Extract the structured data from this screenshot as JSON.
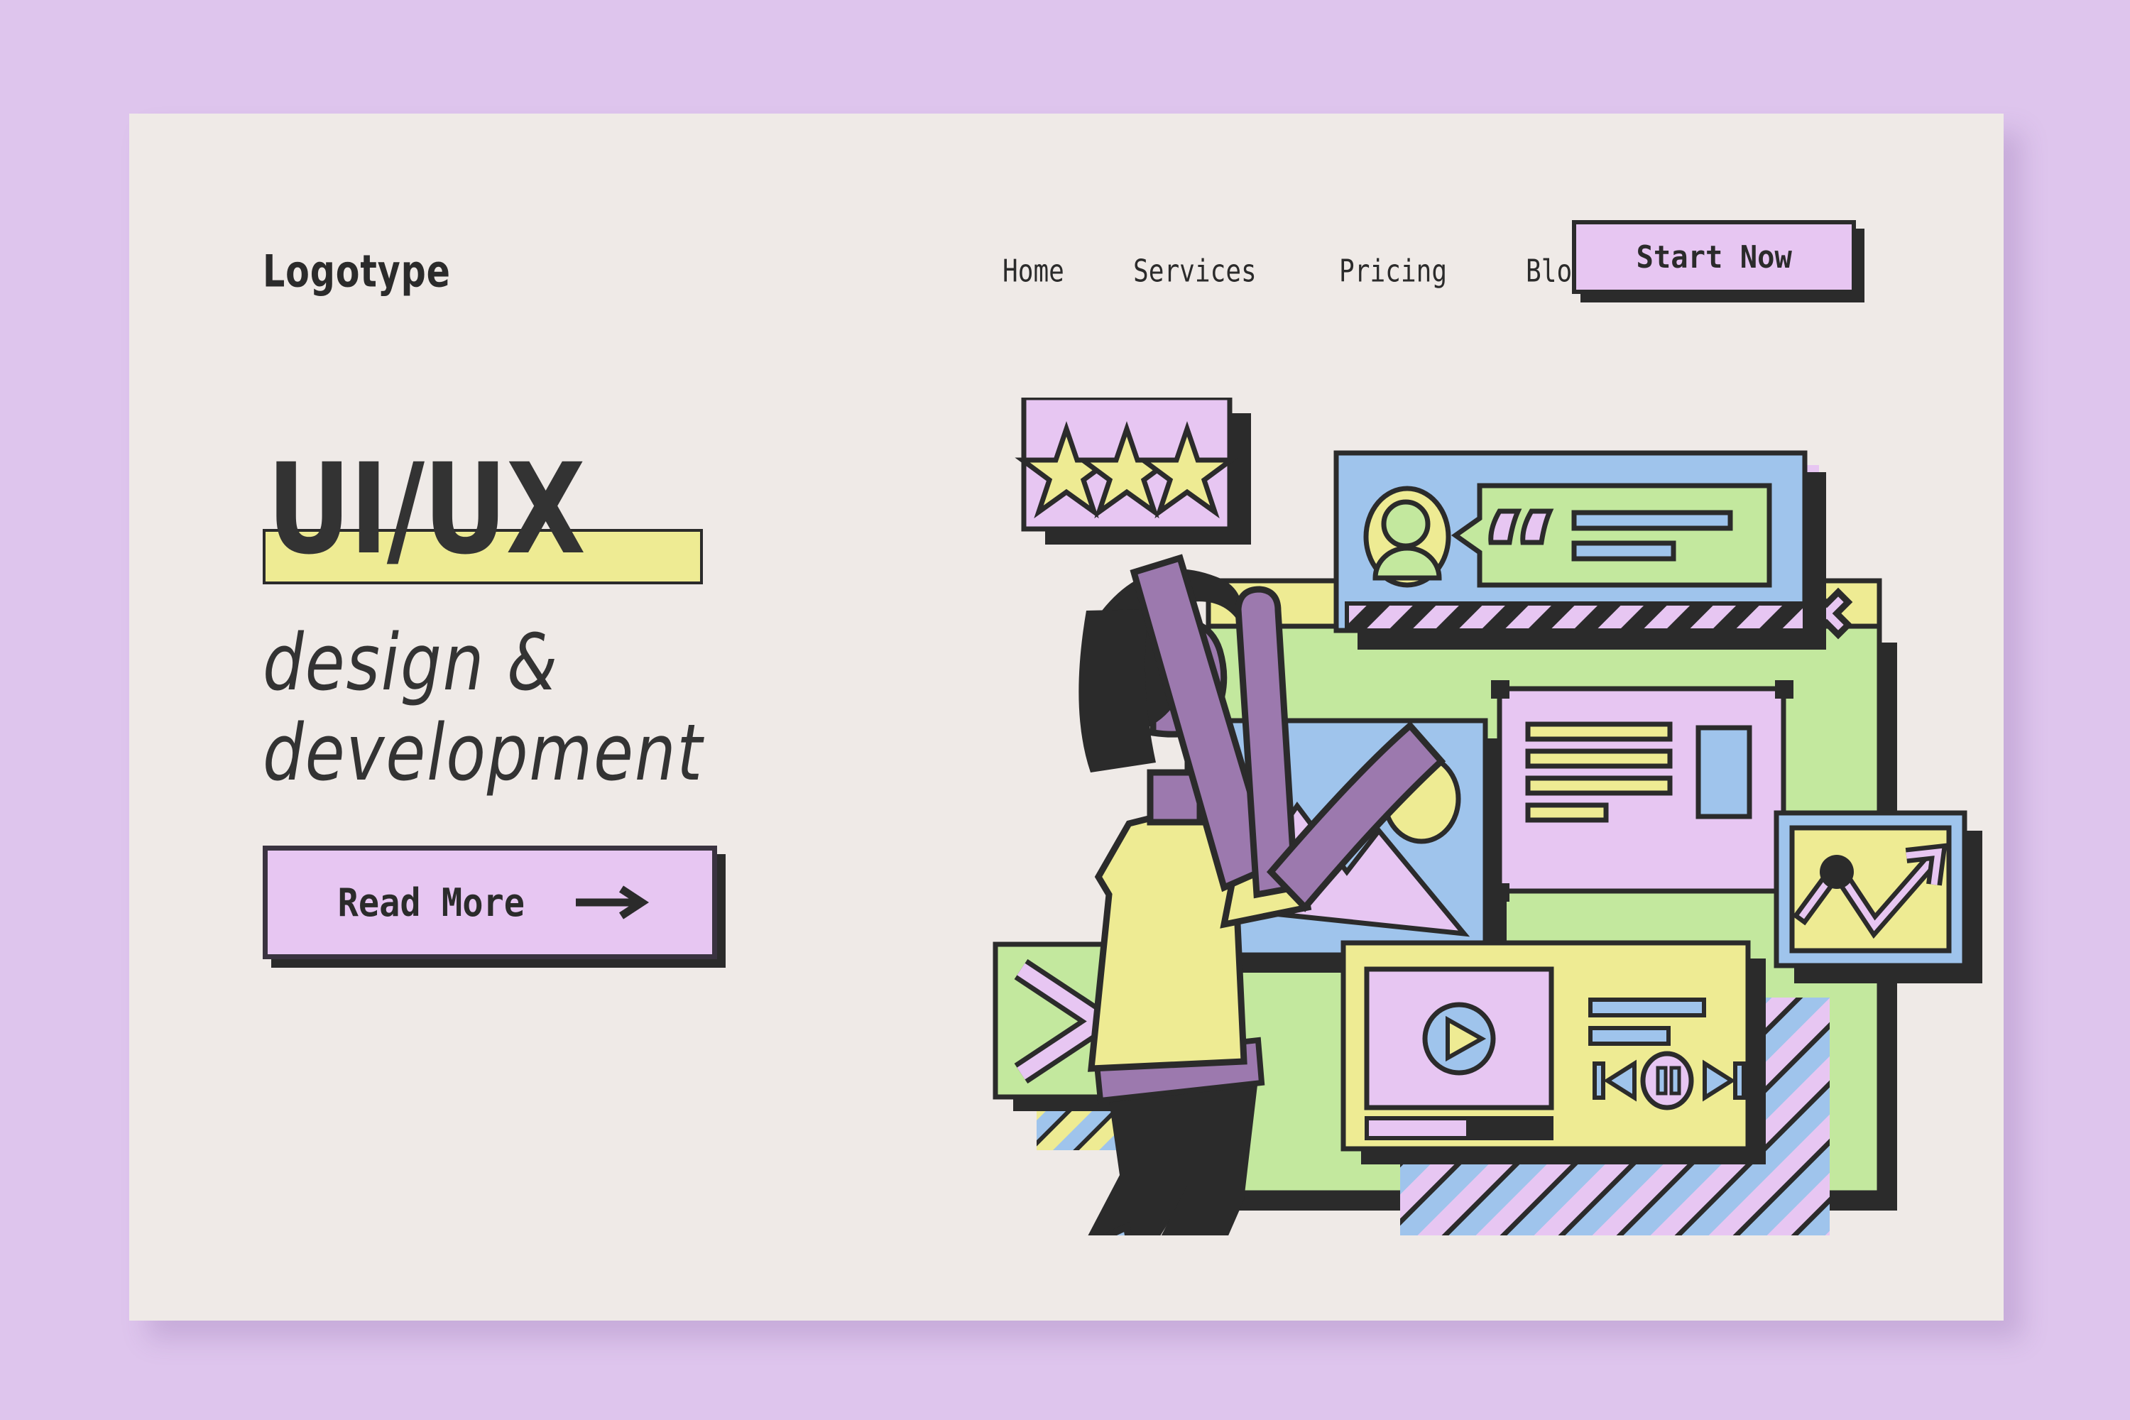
{
  "theme": {
    "page_bg": "#dec5ed",
    "card_bg": "#efeae7",
    "ink": "#2b2b2b",
    "accent_purple": "#e7c6f2",
    "accent_yellow": "#eeeb93",
    "accent_green": "#c3e89e",
    "accent_blue": "#9fc4ec",
    "skin_purple": "#9c79ae"
  },
  "header": {
    "logo": "Logotype",
    "nav": [
      {
        "label": "Home"
      },
      {
        "label": "Services"
      },
      {
        "label": "Pricing"
      },
      {
        "label": "Blog"
      }
    ],
    "cta": {
      "label": "Start Now"
    }
  },
  "hero": {
    "headline": "UI/UX",
    "subheadline": "design &\ndevelopment",
    "cta": {
      "label": "Read More",
      "icon": "arrow-right-icon"
    }
  },
  "illustration": {
    "name": "ui-ux-design-illustration",
    "rating_card": {
      "stars": 3,
      "icon": "star-icon"
    },
    "review_panel": {
      "avatar": "user-avatar-icon",
      "quote_icon": "quote-mark-icon",
      "text_lines": 2
    },
    "close_button": {
      "icon": "close-x-icon"
    },
    "image_card": {
      "icon": "image-placeholder-icon"
    },
    "text_card": {
      "line_count": 4
    },
    "chart_card": {
      "icon": "trend-up-arrow-icon"
    },
    "cancel_card": {
      "icon": "big-x-icon"
    },
    "media_player": {
      "play_icon": "play-circle-icon",
      "prev_icon": "skip-previous-icon",
      "pause_icon": "pause-circle-icon",
      "next_icon": "skip-next-icon",
      "progress_percent": 55
    }
  }
}
